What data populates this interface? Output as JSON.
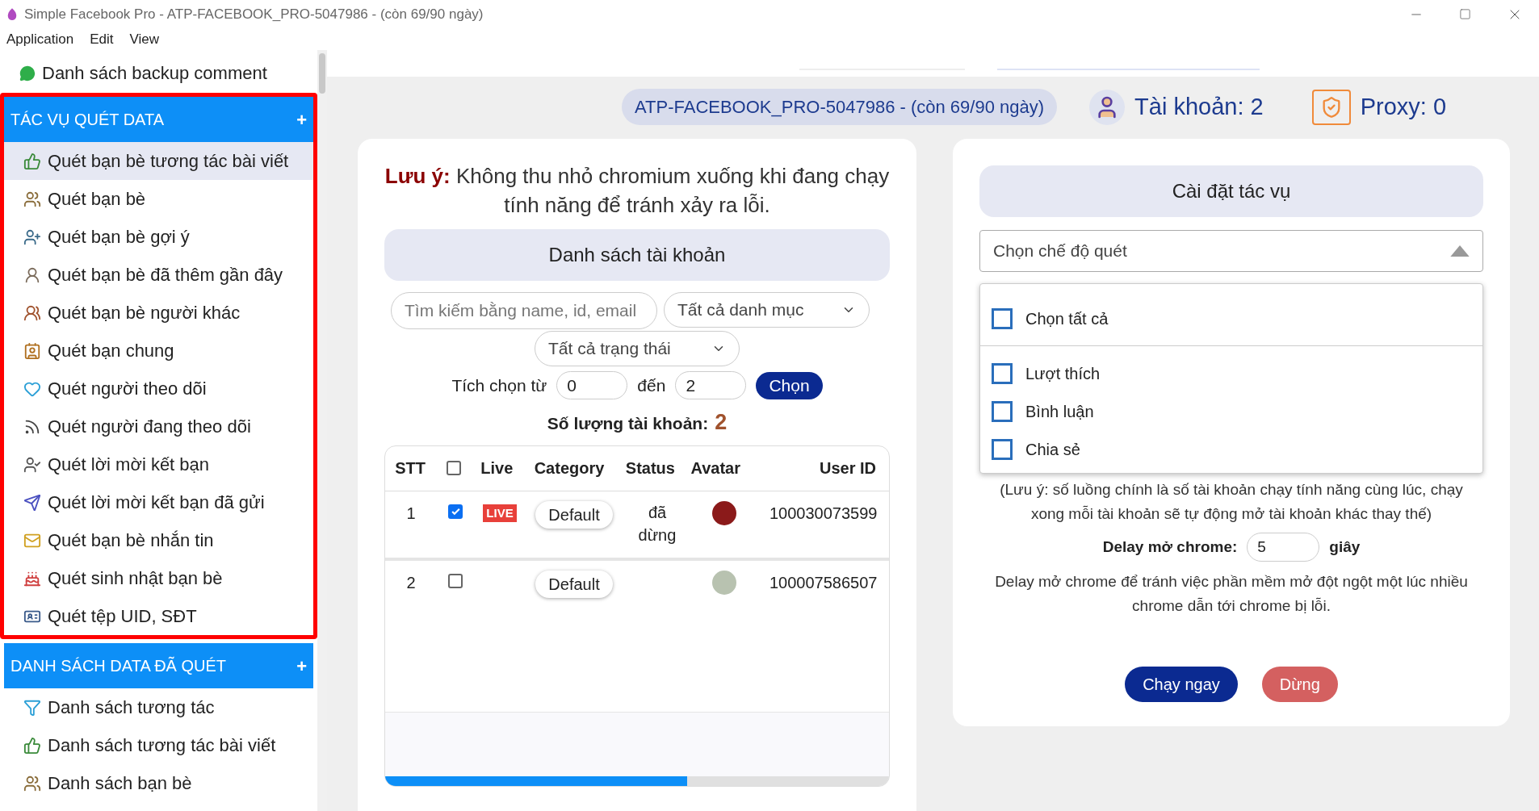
{
  "window": {
    "title": "Simple Facebook Pro - ATP-FACEBOOK_PRO-5047986 - (còn 69/90 ngày)"
  },
  "menu": [
    "Application",
    "Edit",
    "View"
  ],
  "sidebar": {
    "top_item": "Danh sách backup comment",
    "sections": [
      {
        "title": "TÁC VỤ QUÉT DATA",
        "plus": "+",
        "highlighted": true,
        "items": [
          {
            "label": "Quét bạn bè tương tác bài viết",
            "selected": true
          },
          {
            "label": "Quét bạn bè",
            "selected": false
          },
          {
            "label": "Quét bạn bè gợi ý",
            "selected": false
          },
          {
            "label": "Quét bạn bè đã thêm gần đây",
            "selected": false
          },
          {
            "label": "Quét bạn bè người khác",
            "selected": false
          },
          {
            "label": "Quét bạn chung",
            "selected": false
          },
          {
            "label": "Quét người theo dõi",
            "selected": false
          },
          {
            "label": "Quét người đang theo dõi",
            "selected": false
          },
          {
            "label": "Quét lời mời kết bạn",
            "selected": false
          },
          {
            "label": "Quét lời mời kết bạn đã gửi",
            "selected": false
          },
          {
            "label": "Quét bạn bè nhắn tin",
            "selected": false
          },
          {
            "label": "Quét sinh nhật bạn bè",
            "selected": false
          },
          {
            "label": "Quét tệp UID, SĐT",
            "selected": false
          }
        ]
      },
      {
        "title": "DANH SÁCH DATA ĐÃ QUÉT",
        "plus": "+",
        "highlighted": false,
        "items": [
          {
            "label": "Danh sách tương tác",
            "selected": false
          },
          {
            "label": "Danh sách tương tác bài viết",
            "selected": false
          },
          {
            "label": "Danh sách bạn bè",
            "selected": false
          }
        ]
      }
    ]
  },
  "header": {
    "license": "ATP-FACEBOOK_PRO-5047986 - (còn 69/90 ngày)",
    "accounts": "Tài khoản: 2",
    "proxy": "Proxy: 0"
  },
  "accounts_panel": {
    "note": "**Lưu ý:** Không thu nhỏ chromium xuống khi đang chạy tính năng để tránh xảy ra lỗi.",
    "title": "Danh sách tài khoản",
    "search": {
      "placeholder": "Tìm kiếm bằng name, id, email"
    },
    "category_select": "Tất cả danh mục",
    "status_select": "Tất cả trạng thái",
    "range": {
      "label": "Tích chọn từ",
      "from": "0",
      "to_label": "đến",
      "to": "2",
      "button": "Chọn"
    },
    "count_label": "Số lượng tài khoản:",
    "count": "2",
    "table": {
      "columns": [
        "STT",
        "Live",
        "Category",
        "Status",
        "Avatar",
        "User ID"
      ],
      "select_all": false,
      "rows": [
        {
          "stt": "1",
          "checked": true,
          "live": "LIVE",
          "category": "Default",
          "status": "đã dừng",
          "user_id": "100030073599"
        },
        {
          "stt": "2",
          "checked": false,
          "category": "Default",
          "user_id": "100007586507"
        }
      ]
    }
  },
  "settings_panel": {
    "title": "Cài đặt tác vụ",
    "mode_select": {
      "placeholder": "Chọn chế độ quét",
      "expanded": true,
      "options": [
        {
          "label": "Chọn tất cả",
          "checked": false,
          "kind": "select_all"
        },
        {
          "label": "Lượt thích",
          "checked": false,
          "kind": "option"
        },
        {
          "label": "Bình luận",
          "checked": false,
          "kind": "option"
        },
        {
          "label": "Chia sẻ",
          "checked": false,
          "kind": "option"
        }
      ]
    },
    "thread_note": "(Lưu ý: số luồng chính là số tài khoản chạy tính năng cùng lúc, chạy xong mỗi tài khoản sẽ tự động mở tài khoản khác thay thế)",
    "delay": {
      "label": "Delay mở chrome:",
      "value": "5",
      "unit": "giây"
    },
    "delay_note": "Delay mở chrome để tránh việc phần mềm mở đột ngột một lúc nhiều chrome dẫn tới chrome bị lỗi.",
    "buttons": [
      {
        "label": "Chạy ngay",
        "kind": "primary"
      },
      {
        "label": "Dừng",
        "kind": "danger"
      }
    ]
  }
}
